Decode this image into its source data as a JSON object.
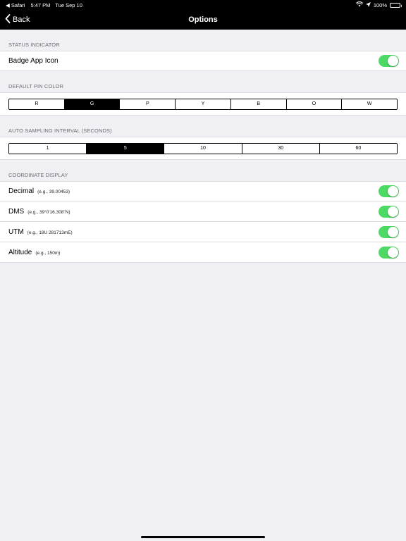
{
  "status_bar": {
    "back_app": "◀ Safari",
    "time": "5:47 PM",
    "date": "Tue Sep 10",
    "battery": "100%"
  },
  "nav": {
    "back_label": "Back",
    "title": "Options"
  },
  "sections": {
    "status_indicator": {
      "header": "STATUS INDICATOR",
      "badge_label": "Badge App Icon",
      "badge_on": true
    },
    "pin_color": {
      "header": "DEFAULT PIN COLOR",
      "options": [
        "R",
        "G",
        "P",
        "Y",
        "B",
        "O",
        "W"
      ],
      "selected": "G"
    },
    "sampling": {
      "header": "AUTO SAMPLING INTERVAL (SECONDS)",
      "options": [
        "1",
        "5",
        "10",
        "30",
        "60"
      ],
      "selected": "5"
    },
    "coordinate": {
      "header": "COORDINATE DISPLAY",
      "rows": [
        {
          "label": "Decimal",
          "example": "(e.g., 39.00453)",
          "on": true
        },
        {
          "label": "DMS",
          "example": "(e.g., 39°0'16.308\"N)",
          "on": true
        },
        {
          "label": "UTM",
          "example": "(e.g., 18U 281713mE)",
          "on": true
        },
        {
          "label": "Altitude",
          "example": "(e.g., 150m)",
          "on": true
        }
      ]
    }
  },
  "colors": {
    "toggle_on": "#4cd964",
    "background": "#efeff4"
  },
  "icons": {
    "back": "chevron-left-icon",
    "wifi": "wifi-icon",
    "location": "location-arrow-icon",
    "battery": "battery-icon"
  }
}
